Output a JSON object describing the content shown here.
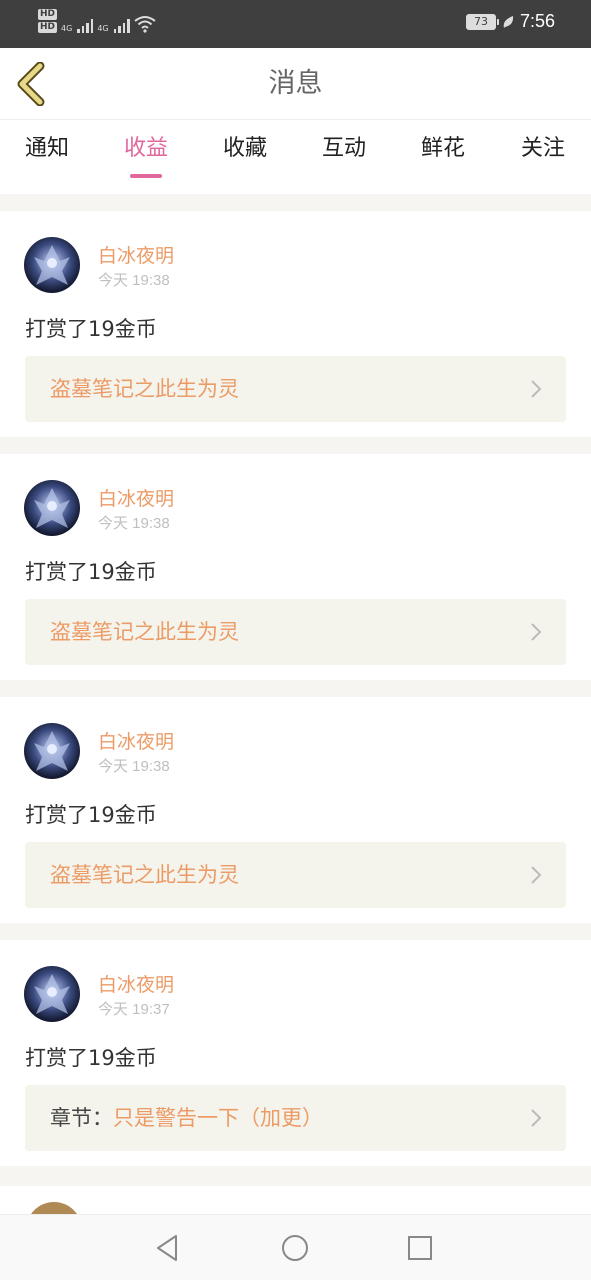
{
  "status_bar": {
    "hd_1": "HD",
    "hd_2": "HD",
    "network_1": "4G",
    "network_2": "4G",
    "battery": "73",
    "time": "7:56"
  },
  "header": {
    "title": "消息",
    "back_icon": "chevron-left-icon"
  },
  "tabs": [
    {
      "label": "通知",
      "active": false
    },
    {
      "label": "收益",
      "active": true
    },
    {
      "label": "收藏",
      "active": false
    },
    {
      "label": "互动",
      "active": false
    },
    {
      "label": "鲜花",
      "active": false
    },
    {
      "label": "关注",
      "active": false
    }
  ],
  "messages": [
    {
      "user": "白冰夜明",
      "time": "今天 19:38",
      "action": "打赏了19金币",
      "link_prefix": "",
      "link_text": "盗墓笔记之此生为灵"
    },
    {
      "user": "白冰夜明",
      "time": "今天 19:38",
      "action": "打赏了19金币",
      "link_prefix": "",
      "link_text": "盗墓笔记之此生为灵"
    },
    {
      "user": "白冰夜明",
      "time": "今天 19:38",
      "action": "打赏了19金币",
      "link_prefix": "",
      "link_text": "盗墓笔记之此生为灵"
    },
    {
      "user": "白冰夜明",
      "time": "今天 19:37",
      "action": "打赏了19金币",
      "link_prefix": "章节：",
      "link_text": "只是警告一下（加更）"
    }
  ],
  "colors": {
    "accent_pink": "#e0689c",
    "accent_orange": "#ec9b67",
    "link_bg": "#f4f4ec",
    "status_bar_bg": "#3f3f3f"
  },
  "nav_icons": [
    "back-triangle-icon",
    "home-circle-icon",
    "recents-square-icon"
  ]
}
